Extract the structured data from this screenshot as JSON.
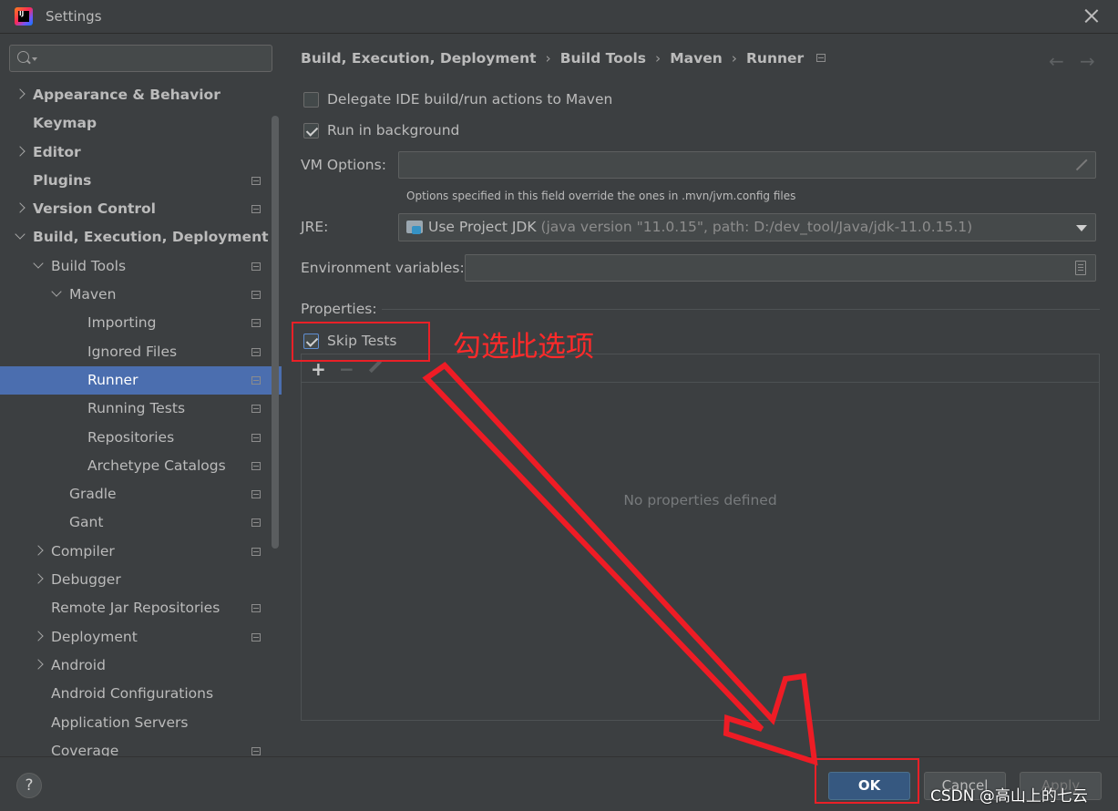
{
  "window": {
    "title": "Settings"
  },
  "search": {
    "placeholder": ""
  },
  "tree": [
    {
      "label": "Appearance & Behavior",
      "level": 0,
      "arrow": "right",
      "bold": true,
      "page": false
    },
    {
      "label": "Keymap",
      "level": 0,
      "arrow": "none",
      "bold": true,
      "page": false
    },
    {
      "label": "Editor",
      "level": 0,
      "arrow": "right",
      "bold": true,
      "page": false
    },
    {
      "label": "Plugins",
      "level": 0,
      "arrow": "none",
      "bold": true,
      "page": true
    },
    {
      "label": "Version Control",
      "level": 0,
      "arrow": "right",
      "bold": true,
      "page": true
    },
    {
      "label": "Build, Execution, Deployment",
      "level": 0,
      "arrow": "down",
      "bold": true,
      "page": false
    },
    {
      "label": "Build Tools",
      "level": 1,
      "arrow": "down",
      "bold": false,
      "page": true
    },
    {
      "label": "Maven",
      "level": 2,
      "arrow": "down",
      "bold": false,
      "page": true
    },
    {
      "label": "Importing",
      "level": 3,
      "arrow": "none",
      "bold": false,
      "page": true
    },
    {
      "label": "Ignored Files",
      "level": 3,
      "arrow": "none",
      "bold": false,
      "page": true
    },
    {
      "label": "Runner",
      "level": 3,
      "arrow": "none",
      "bold": false,
      "page": true,
      "selected": true
    },
    {
      "label": "Running Tests",
      "level": 3,
      "arrow": "none",
      "bold": false,
      "page": true
    },
    {
      "label": "Repositories",
      "level": 3,
      "arrow": "none",
      "bold": false,
      "page": true
    },
    {
      "label": "Archetype Catalogs",
      "level": 3,
      "arrow": "none",
      "bold": false,
      "page": true
    },
    {
      "label": "Gradle",
      "level": 2,
      "arrow": "none",
      "bold": false,
      "page": true
    },
    {
      "label": "Gant",
      "level": 2,
      "arrow": "none",
      "bold": false,
      "page": true
    },
    {
      "label": "Compiler",
      "level": 1,
      "arrow": "right",
      "bold": false,
      "page": true
    },
    {
      "label": "Debugger",
      "level": 1,
      "arrow": "right",
      "bold": false,
      "page": false
    },
    {
      "label": "Remote Jar Repositories",
      "level": 1,
      "arrow": "none",
      "bold": false,
      "page": true
    },
    {
      "label": "Deployment",
      "level": 1,
      "arrow": "right",
      "bold": false,
      "page": true
    },
    {
      "label": "Android",
      "level": 1,
      "arrow": "right",
      "bold": false,
      "page": false
    },
    {
      "label": "Android Configurations",
      "level": 1,
      "arrow": "none",
      "bold": false,
      "page": false
    },
    {
      "label": "Application Servers",
      "level": 1,
      "arrow": "none",
      "bold": false,
      "page": false
    },
    {
      "label": "Coverage",
      "level": 1,
      "arrow": "none",
      "bold": false,
      "page": true
    }
  ],
  "breadcrumb": {
    "items": [
      "Build, Execution, Deployment",
      "Build Tools",
      "Maven",
      "Runner"
    ],
    "separator": "›"
  },
  "nav": {
    "back": "←",
    "forward": "→"
  },
  "options": {
    "delegate": {
      "label": "Delegate IDE build/run actions to Maven",
      "checked": false
    },
    "background": {
      "label": "Run in background",
      "checked": true
    },
    "skip_tests": {
      "label": "Skip Tests",
      "checked": true
    }
  },
  "vm_options": {
    "label": "VM Options:",
    "value": "",
    "hint": "Options specified in this field override the ones in .mvn/jvm.config files"
  },
  "jre": {
    "label": "JRE:",
    "value": "Use Project JDK",
    "detail": " (java version \"11.0.15\", path: D:/dev_tool/Java/jdk-11.0.15.1)"
  },
  "env_vars": {
    "label": "Environment variables:",
    "value": ""
  },
  "properties": {
    "label": "Properties:",
    "empty_text": "No properties defined",
    "add": "+",
    "remove": "−"
  },
  "buttons": {
    "help": "?",
    "ok": "OK",
    "cancel": "Cancel",
    "apply": "Apply"
  },
  "annotation": {
    "text": "勾选此选项"
  },
  "watermark": "CSDN @高山上的七云",
  "colors": {
    "selection": "#4b6eaf",
    "annotation": "#ea2027",
    "ok_button": "#365880"
  }
}
